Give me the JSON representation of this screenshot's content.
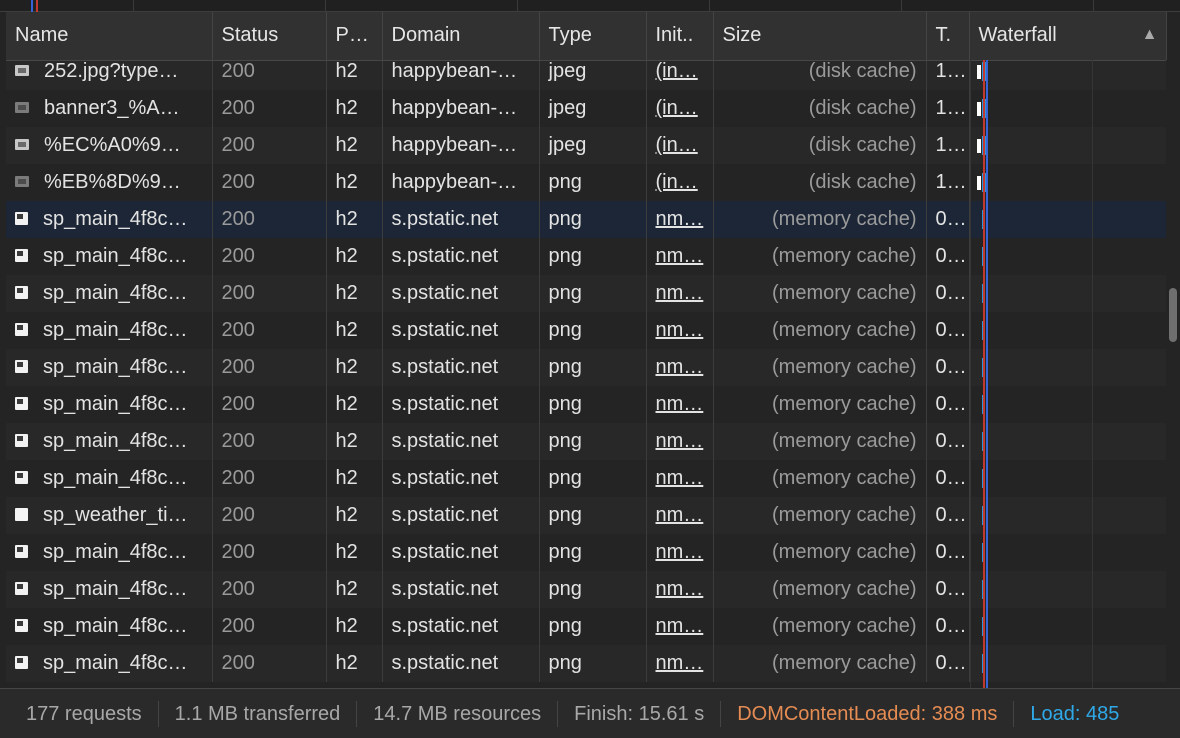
{
  "columns": {
    "name": "Name",
    "status": "Status",
    "protocol": "P…",
    "domain": "Domain",
    "type": "Type",
    "initiator": "Init..",
    "size": "Size",
    "time": "T.",
    "waterfall": "Waterfall",
    "sort_icon": "▲"
  },
  "rows": [
    {
      "name": "252.jpg?type…",
      "status": "200",
      "protocol": "h2",
      "domain": "happybean-…",
      "type": "jpeg",
      "initiator": "(in…",
      "size": "(disk cache)",
      "time": "1…",
      "icon": "image-icon"
    },
    {
      "name": "banner3_%A…",
      "status": "200",
      "protocol": "h2",
      "domain": "happybean-…",
      "type": "jpeg",
      "initiator": "(in…",
      "size": "(disk cache)",
      "time": "1…",
      "icon": "image-icon"
    },
    {
      "name": "%EC%A0%9…",
      "status": "200",
      "protocol": "h2",
      "domain": "happybean-…",
      "type": "jpeg",
      "initiator": "(in…",
      "size": "(disk cache)",
      "time": "1…",
      "icon": "image-icon"
    },
    {
      "name": "%EB%8D%9…",
      "status": "200",
      "protocol": "h2",
      "domain": "happybean-…",
      "type": "png",
      "initiator": "(in…",
      "size": "(disk cache)",
      "time": "1…",
      "icon": "image-icon"
    },
    {
      "name": "sp_main_4f8c…",
      "status": "200",
      "protocol": "h2",
      "domain": "s.pstatic.net",
      "type": "png",
      "initiator": "nm…",
      "size": "(memory cache)",
      "time": "0…",
      "icon": "sprite-image-icon",
      "selected": true
    },
    {
      "name": "sp_main_4f8c…",
      "status": "200",
      "protocol": "h2",
      "domain": "s.pstatic.net",
      "type": "png",
      "initiator": "nm…",
      "size": "(memory cache)",
      "time": "0…",
      "icon": "sprite-image-icon"
    },
    {
      "name": "sp_main_4f8c…",
      "status": "200",
      "protocol": "h2",
      "domain": "s.pstatic.net",
      "type": "png",
      "initiator": "nm…",
      "size": "(memory cache)",
      "time": "0…",
      "icon": "sprite-image-icon"
    },
    {
      "name": "sp_main_4f8c…",
      "status": "200",
      "protocol": "h2",
      "domain": "s.pstatic.net",
      "type": "png",
      "initiator": "nm…",
      "size": "(memory cache)",
      "time": "0…",
      "icon": "sprite-image-icon"
    },
    {
      "name": "sp_main_4f8c…",
      "status": "200",
      "protocol": "h2",
      "domain": "s.pstatic.net",
      "type": "png",
      "initiator": "nm…",
      "size": "(memory cache)",
      "time": "0…",
      "icon": "sprite-image-icon"
    },
    {
      "name": "sp_main_4f8c…",
      "status": "200",
      "protocol": "h2",
      "domain": "s.pstatic.net",
      "type": "png",
      "initiator": "nm…",
      "size": "(memory cache)",
      "time": "0…",
      "icon": "sprite-image-icon"
    },
    {
      "name": "sp_main_4f8c…",
      "status": "200",
      "protocol": "h2",
      "domain": "s.pstatic.net",
      "type": "png",
      "initiator": "nm…",
      "size": "(memory cache)",
      "time": "0…",
      "icon": "sprite-image-icon"
    },
    {
      "name": "sp_main_4f8c…",
      "status": "200",
      "protocol": "h2",
      "domain": "s.pstatic.net",
      "type": "png",
      "initiator": "nm…",
      "size": "(memory cache)",
      "time": "0…",
      "icon": "sprite-image-icon"
    },
    {
      "name": "sp_weather_ti…",
      "status": "200",
      "protocol": "h2",
      "domain": "s.pstatic.net",
      "type": "png",
      "initiator": "nm…",
      "size": "(memory cache)",
      "time": "0…",
      "icon": "blank-image-icon"
    },
    {
      "name": "sp_main_4f8c…",
      "status": "200",
      "protocol": "h2",
      "domain": "s.pstatic.net",
      "type": "png",
      "initiator": "nm…",
      "size": "(memory cache)",
      "time": "0…",
      "icon": "sprite-image-icon"
    },
    {
      "name": "sp_main_4f8c…",
      "status": "200",
      "protocol": "h2",
      "domain": "s.pstatic.net",
      "type": "png",
      "initiator": "nm…",
      "size": "(memory cache)",
      "time": "0…",
      "icon": "sprite-image-icon"
    },
    {
      "name": "sp_main_4f8c…",
      "status": "200",
      "protocol": "h2",
      "domain": "s.pstatic.net",
      "type": "png",
      "initiator": "nm…",
      "size": "(memory cache)",
      "time": "0…",
      "icon": "sprite-image-icon"
    },
    {
      "name": "sp_main_4f8c…",
      "status": "200",
      "protocol": "h2",
      "domain": "s.pstatic.net",
      "type": "png",
      "initiator": "nm…",
      "size": "(memory cache)",
      "time": "0…",
      "icon": "sprite-image-icon"
    }
  ],
  "statusbar": {
    "requests": "177 requests",
    "transferred": "1.1 MB transferred",
    "resources": "14.7 MB resources",
    "finish": "Finish: 15.61 s",
    "dom_content_loaded": "DOMContentLoaded: 388 ms",
    "load": "Load: 485"
  },
  "colors": {
    "dom_content_loaded": "#e58c53",
    "load": "#2fa9e8",
    "selected_row": "#1c2636",
    "waterfall_bar": "#2e93d8"
  }
}
